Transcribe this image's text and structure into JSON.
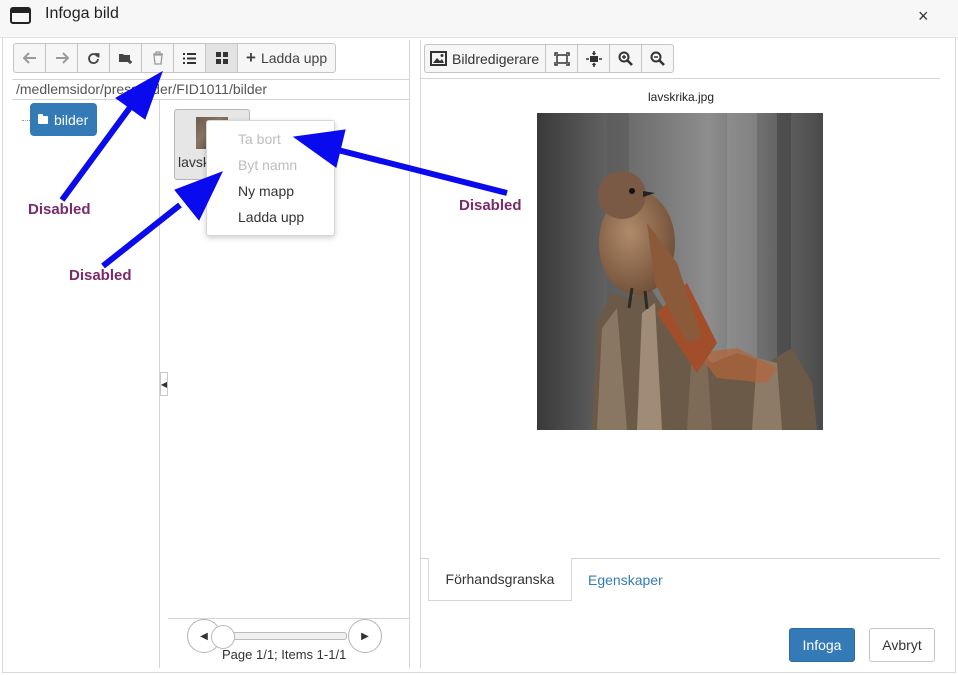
{
  "dialog": {
    "title": "Infoga bild",
    "close_label": "×"
  },
  "toolbar": {
    "back_icon": "arrow-left-icon",
    "forward_icon": "arrow-right-icon",
    "refresh_icon": "refresh-icon",
    "new_folder_icon": "folder-plus-icon",
    "delete_icon": "trash-icon",
    "list_view_icon": "list-view-icon",
    "grid_view_icon": "grid-view-icon",
    "upload_plus": "+",
    "upload_label": "Ladda upp"
  },
  "path": "/medlemsidor/pressbilder/FID1011/bilder",
  "tree": {
    "root_label": "bilder"
  },
  "file_list": {
    "items": [
      {
        "name": "lavskrika.jpg"
      }
    ]
  },
  "context_menu": {
    "items": [
      {
        "label": "Ta bort",
        "disabled": true
      },
      {
        "label": "Byt namn",
        "disabled": true
      },
      {
        "label": "Ny mapp",
        "disabled": false
      },
      {
        "label": "Ladda upp",
        "disabled": false
      }
    ]
  },
  "pager": {
    "prev_label": "◀",
    "next_label": "▶",
    "text": "Page 1/1; Items 1-1/1"
  },
  "right_toolbar": {
    "editor_label": "Bildredigerare",
    "editor_icon": "image-edit-icon",
    "fit_icon": "fit-to-window-icon",
    "actual_size_icon": "actual-size-icon",
    "zoom_in_icon": "zoom-in-icon",
    "zoom_out_icon": "zoom-out-icon"
  },
  "preview": {
    "filename": "lavskrika.jpg"
  },
  "tabs": {
    "preview_label": "Förhandsgranska",
    "properties_label": "Egenskaper"
  },
  "buttons": {
    "insert_label": "Infoga",
    "cancel_label": "Avbryt"
  },
  "annotations": {
    "label_1": "Disabled",
    "label_2": "Disabled",
    "label_3": "Disabled",
    "arrow_color": "#0a0aee",
    "label_color": "#7a2a6c"
  },
  "colors": {
    "primary": "#337ab7",
    "disabled_text": "#bdbdbd"
  }
}
